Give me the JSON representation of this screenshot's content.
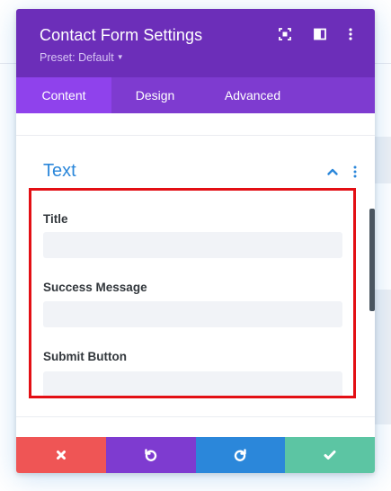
{
  "modal": {
    "title": "Contact Form Settings",
    "preset_label": "Preset: Default",
    "header_icons": [
      "fullscreen-icon",
      "sidebar-toggle-icon",
      "more-options-icon"
    ]
  },
  "tabs": [
    {
      "label": "Content",
      "active": true
    },
    {
      "label": "Design",
      "active": false
    },
    {
      "label": "Advanced",
      "active": false
    }
  ],
  "section": {
    "title": "Text",
    "expanded": true
  },
  "fields": {
    "title": {
      "label": "Title",
      "value": ""
    },
    "success_message": {
      "label": "Success Message",
      "value": ""
    },
    "submit_button": {
      "label": "Submit Button",
      "value": ""
    }
  },
  "footer": {
    "buttons": [
      "cancel-icon",
      "undo-icon",
      "redo-icon",
      "save-check-icon"
    ]
  },
  "colors": {
    "header": "#6c2eb9",
    "tabs": "#7e3bd0",
    "active_tab": "#8f42ec",
    "accent_blue": "#2b87da",
    "cancel": "#ef5555",
    "save": "#5cc5a3",
    "highlight": "#e30f14"
  }
}
